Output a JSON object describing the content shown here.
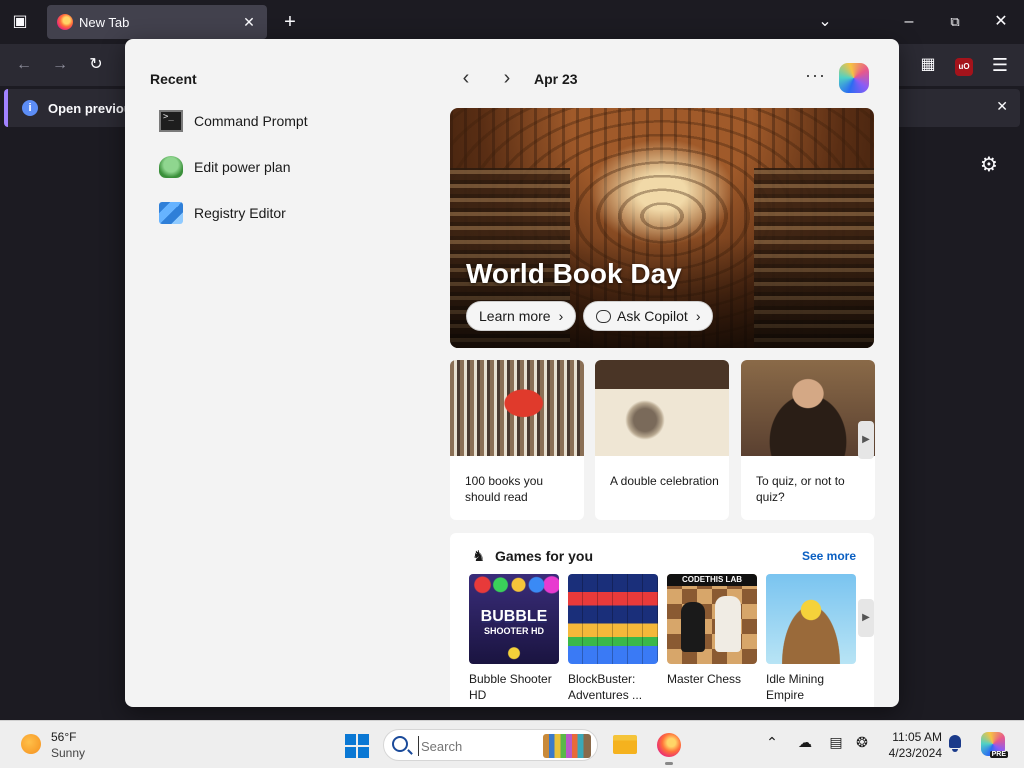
{
  "browser": {
    "tab_title": "New Tab",
    "notice_text": "Open previous",
    "extension_badge": "uO"
  },
  "widgets": {
    "recent_title": "Recent",
    "recent_items": [
      {
        "label": "Command Prompt",
        "icon": "command-prompt-icon"
      },
      {
        "label": "Edit power plan",
        "icon": "power-plan-icon"
      },
      {
        "label": "Registry Editor",
        "icon": "registry-editor-icon"
      }
    ],
    "date": "Apr 23",
    "hero": {
      "headline": "World Book Day",
      "learn_more": "Learn more",
      "ask_copilot": "Ask Copilot"
    },
    "cards": [
      {
        "caption": "100 books you should read"
      },
      {
        "caption": "A double celebration"
      },
      {
        "caption": "To quiz, or not to quiz?"
      }
    ],
    "games": {
      "title": "Games for you",
      "see_more": "See more",
      "items": [
        {
          "name": "Bubble Shooter HD",
          "tile_text": "BUBBLE",
          "tile_subtext": "SHOOTER HD"
        },
        {
          "name": "BlockBuster: Adventures ..."
        },
        {
          "name": "Master Chess",
          "tile_text": "CODETHIS LAB"
        },
        {
          "name": "Idle Mining Empire"
        }
      ]
    }
  },
  "taskbar": {
    "temperature": "56°F",
    "condition": "Sunny",
    "search_placeholder": "Search",
    "time": "11:05 AM",
    "date": "4/23/2024",
    "copilot_badge": "PRE"
  },
  "colors": {
    "accent": "#0a78d4",
    "link": "#0a5fc2",
    "notice_border": "#a283ff"
  }
}
